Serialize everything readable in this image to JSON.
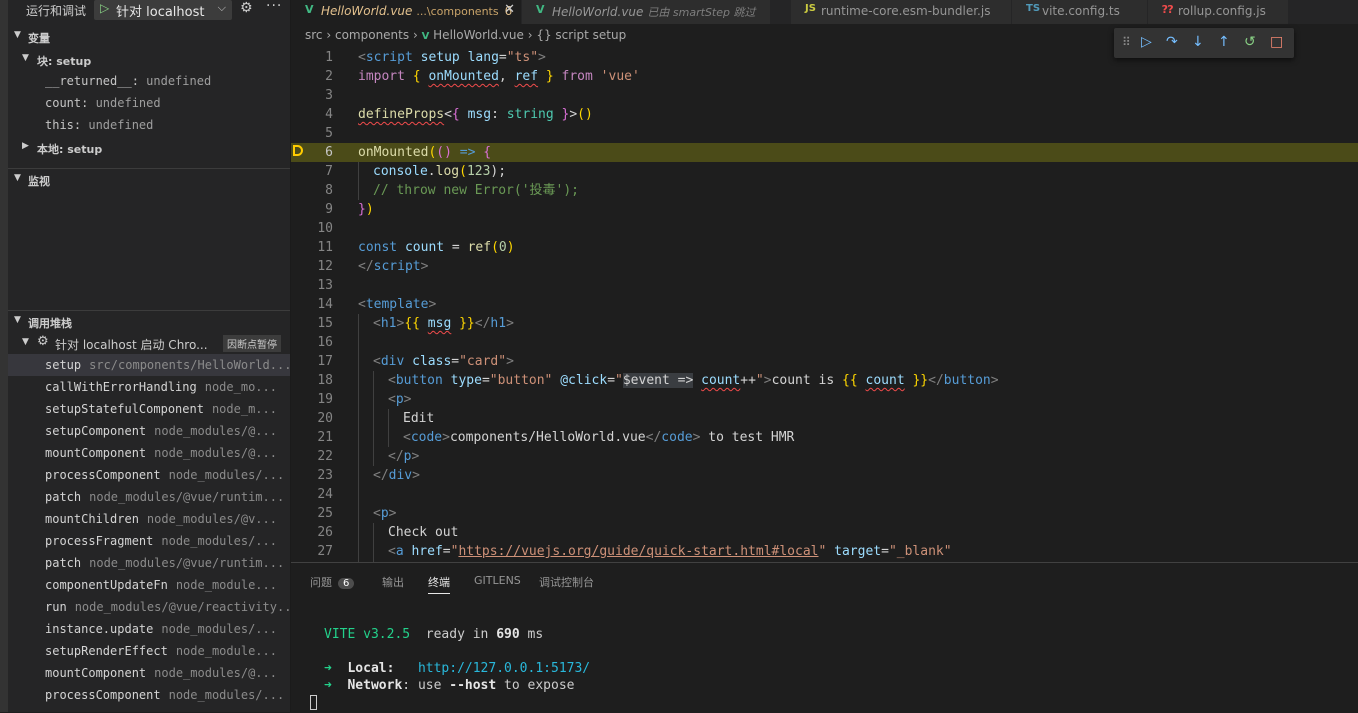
{
  "sidebar": {
    "header_title": "运行和调试",
    "run_config": "针对 localhost 启动",
    "variables": {
      "title": "变量",
      "block_label": "块: setup",
      "items": [
        {
          "name": "__returned__",
          "value": "undefined"
        },
        {
          "name": "count",
          "value": "undefined"
        },
        {
          "name": "this",
          "value": "undefined"
        }
      ],
      "local_label": "本地: setup"
    },
    "watch": {
      "title": "监视"
    },
    "callstack": {
      "title": "调用堆栈",
      "thread": "针对 localhost 启动 Chro...",
      "thread_badge": "因断点暂停",
      "frames": [
        {
          "fn": "setup",
          "path": "src/components/HelloWorld...."
        },
        {
          "fn": "callWithErrorHandling",
          "path": "node_mo..."
        },
        {
          "fn": "setupStatefulComponent",
          "path": "node_m..."
        },
        {
          "fn": "setupComponent",
          "path": "node_modules/@..."
        },
        {
          "fn": "mountComponent",
          "path": "node_modules/@..."
        },
        {
          "fn": "processComponent",
          "path": "node_modules/..."
        },
        {
          "fn": "patch",
          "path": "node_modules/@vue/runtim..."
        },
        {
          "fn": "mountChildren",
          "path": "node_modules/@v..."
        },
        {
          "fn": "processFragment",
          "path": "node_modules/..."
        },
        {
          "fn": "patch",
          "path": "node_modules/@vue/runtim..."
        },
        {
          "fn": "componentUpdateFn",
          "path": "node_module..."
        },
        {
          "fn": "run",
          "path": "node_modules/@vue/reactivity..."
        },
        {
          "fn": "instance.update",
          "path": "node_modules/..."
        },
        {
          "fn": "setupRenderEffect",
          "path": "node_module..."
        },
        {
          "fn": "mountComponent",
          "path": "node_modules/@..."
        },
        {
          "fn": "processComponent",
          "path": "node_modules/..."
        }
      ]
    }
  },
  "tabs": [
    {
      "name": "HelloWorld.vue",
      "desc": "...\\components",
      "badge": "6",
      "icon": "V"
    },
    {
      "name": "HelloWorld.vue",
      "desc": "已由 smartStep 跳过",
      "icon": "V"
    },
    {
      "name": "runtime-core.esm-bundler.js",
      "icon": "JS"
    },
    {
      "name": "vite.config.ts",
      "icon": "TS"
    },
    {
      "name": "rollup.config.js",
      "icon": "⁇"
    }
  ],
  "breadcrumb": {
    "p1": "src",
    "p2": "components",
    "p3": "HelloWorld.vue",
    "p4": "{} script setup"
  },
  "code": {
    "l1": [
      "<",
      "script",
      " ",
      "setup",
      " ",
      "lang",
      "=",
      "\"ts\"",
      ">"
    ],
    "l2": [
      "import",
      " ",
      "{",
      " ",
      "onMounted",
      ", ",
      "ref",
      " ",
      "}",
      " ",
      "from",
      " ",
      "'vue'"
    ],
    "l4": [
      "defineProps",
      "<",
      "{",
      " ",
      "msg",
      ": ",
      "string",
      " ",
      "}",
      ">",
      "(",
      ")"
    ],
    "l6": [
      "onMounted",
      "(",
      "(",
      ")",
      " ",
      "=>",
      " ",
      "{"
    ],
    "l7": [
      "console",
      ".",
      "log",
      "(",
      "123",
      ");"
    ],
    "l8": "// throw new Error('投毒');",
    "l9": [
      "}",
      ")"
    ],
    "l11": [
      "const",
      " ",
      "count",
      " = ",
      "ref",
      "(",
      "0",
      ")"
    ],
    "l12": [
      "</",
      "script",
      ">"
    ],
    "l14": [
      "<",
      "template",
      ">"
    ],
    "l15": [
      "<",
      "h1",
      ">",
      "{{",
      " ",
      "msg",
      " ",
      "}}",
      "</",
      "h1",
      ">"
    ],
    "l17": [
      "<",
      "div",
      " ",
      "class",
      "=",
      "\"card\"",
      ">"
    ],
    "l18": [
      "<",
      "button",
      " ",
      "type",
      "=",
      "\"button\"",
      " ",
      "@click",
      "=",
      "\"",
      "$event",
      " ",
      "=>",
      " ",
      "count",
      "++",
      "\"",
      ">",
      "count is ",
      "{{",
      " ",
      "count",
      " ",
      "}}",
      "</",
      "button",
      ">"
    ],
    "l19": [
      "<",
      "p",
      ">"
    ],
    "l20": "Edit",
    "l21": [
      "<",
      "code",
      ">",
      "components/HelloWorld.vue",
      "</",
      "code",
      ">",
      " to test HMR"
    ],
    "l22": [
      "</",
      "p",
      ">"
    ],
    "l23": [
      "</",
      "div",
      ">"
    ],
    "l25": [
      "<",
      "p",
      ">"
    ],
    "l26": "Check out",
    "l27": [
      "<",
      "a",
      " ",
      "href",
      "=",
      "\"",
      "https://vuejs.org/guide/quick-start.html#local",
      "\"",
      " ",
      "target",
      "=",
      "\"_blank\""
    ]
  },
  "panel": {
    "tabs": [
      "问题",
      "输出",
      "终端",
      "GITLENS",
      "调试控制台"
    ],
    "problems_badge": "6",
    "terminal": {
      "vite": "VITE",
      "version": "v3.2.5",
      "ready": "ready in",
      "ms_value": "690",
      "ms": "ms",
      "arrow": "➜",
      "local_label": "Local",
      "local_url": "http://127.0.0.1:5173/",
      "network_label": "Network",
      "network_text": "use",
      "host_flag": "--host",
      "expose": "to expose"
    }
  }
}
